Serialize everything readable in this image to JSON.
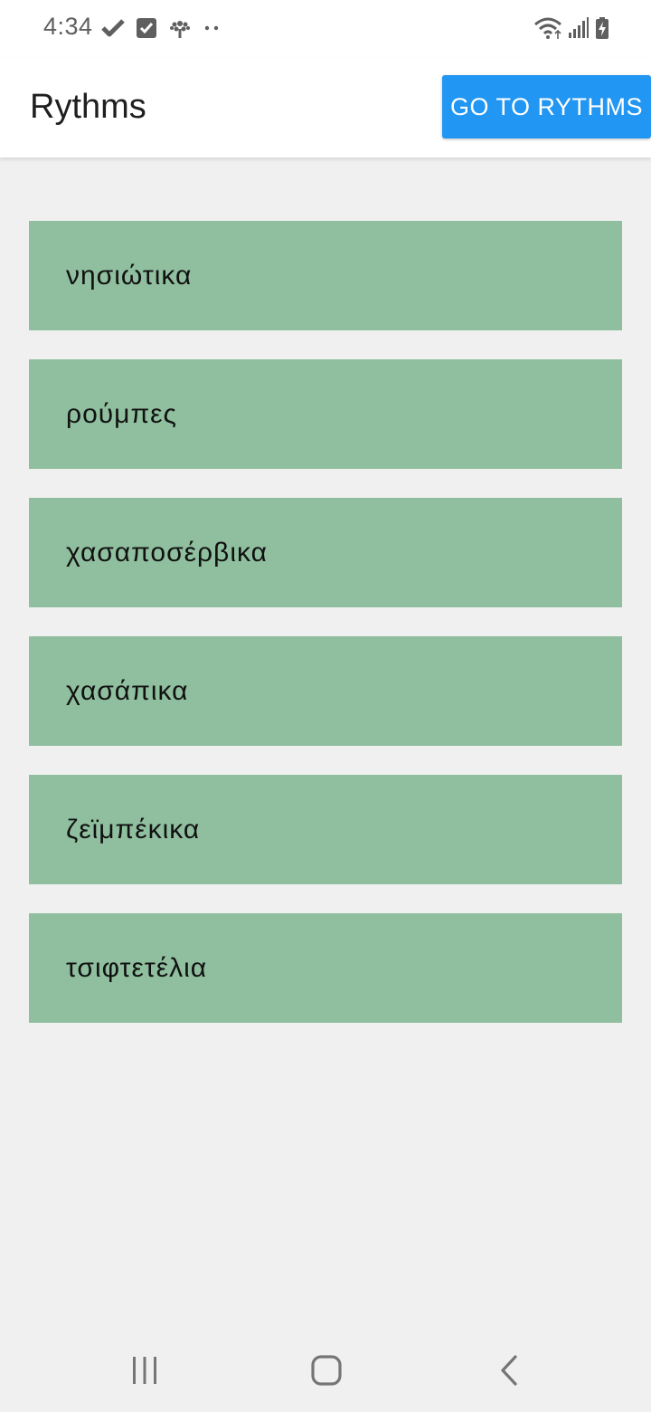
{
  "status_bar": {
    "time": "4:34",
    "left_icons": [
      "check-icon",
      "checkbox-icon",
      "tree-icon",
      "more-dots-icon"
    ],
    "right_icons": [
      "wifi-icon",
      "signal-icon",
      "battery-charging-icon"
    ]
  },
  "app_bar": {
    "title": "Rythms",
    "button_label": "GO TO RYTHMS",
    "button_color": "#2196f3"
  },
  "rhythms": {
    "item_color": "#8fbf9f",
    "items": [
      {
        "label": "νησιώτικα"
      },
      {
        "label": "ρούμπες"
      },
      {
        "label": "χασαποσέρβικα"
      },
      {
        "label": "χασάπικα"
      },
      {
        "label": "ζεϊμπέκικα"
      },
      {
        "label": "τσιφτετέλια"
      }
    ]
  },
  "nav_bar": {
    "buttons": [
      "recent-apps-icon",
      "home-icon",
      "back-icon"
    ]
  }
}
